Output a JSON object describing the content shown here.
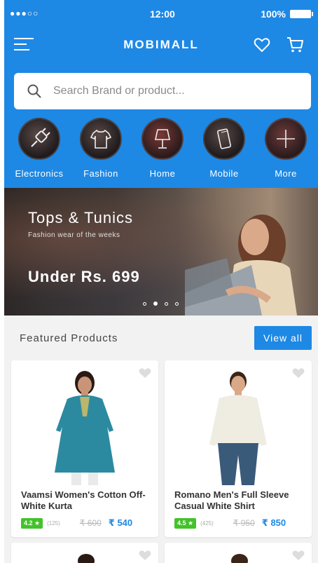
{
  "status_bar": {
    "signal": "●●●○○",
    "time": "12:00",
    "battery": "100%"
  },
  "app": {
    "title": "MOBIMALL"
  },
  "search": {
    "placeholder": "Search Brand or product..."
  },
  "categories": [
    {
      "label": "Electronics",
      "icon": "plug-icon"
    },
    {
      "label": "Fashion",
      "icon": "tshirt-icon"
    },
    {
      "label": "Home",
      "icon": "lamp-icon"
    },
    {
      "label": "Mobile",
      "icon": "phone-icon"
    },
    {
      "label": "More",
      "icon": "plus-icon"
    }
  ],
  "banner": {
    "title": "Tops & Tunics",
    "subtitle": "Fashion wear of the weeks",
    "price_text": "Under Rs. 699",
    "slides": 4,
    "active_slide": 2
  },
  "featured": {
    "title": "Featured Products",
    "view_all_label": "View all"
  },
  "products": [
    {
      "name": "Vaamsi Women's Cotton Off-White Kurta",
      "rating": "4.2 ★",
      "reviews": "(125)",
      "old_price": "₹ 600",
      "new_price": "₹ 540"
    },
    {
      "name": "Romano Men's Full Sleeve Casual White Shirt",
      "rating": "4.5 ★",
      "reviews": "(425)",
      "old_price": "₹ 950",
      "new_price": "₹ 850"
    }
  ],
  "colors": {
    "primary": "#1e88e5",
    "rating_green": "#43c22a",
    "background": "#f2f2f2"
  }
}
